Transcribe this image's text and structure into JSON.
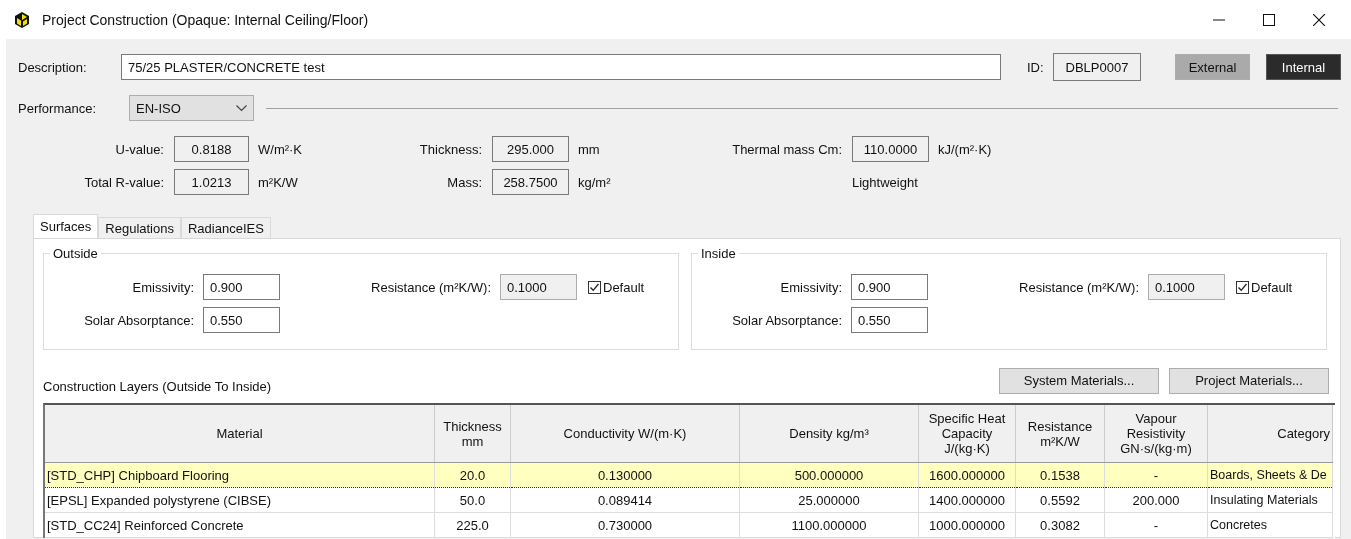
{
  "window": {
    "title": "Project Construction (Opaque: Internal Ceiling/Floor)"
  },
  "description": {
    "label": "Description:",
    "value": "75/25 PLASTER/CONCRETE test"
  },
  "id": {
    "label": "ID:",
    "value": "DBLP0007"
  },
  "modes": [
    {
      "label": "External",
      "selected": false
    },
    {
      "label": "Internal",
      "selected": true
    }
  ],
  "performance": {
    "label": "Performance:",
    "value": "EN-ISO"
  },
  "property_columns": [
    {
      "items": [
        {
          "kind": "field",
          "label": "U-value:",
          "value": "0.8188",
          "unit": "W/m²·K"
        },
        {
          "kind": "field",
          "label": "Total R-value:",
          "value": "1.0213",
          "unit": "m²K/W"
        }
      ]
    },
    {
      "items": [
        {
          "kind": "field",
          "label": "Thickness:",
          "value": "295.000",
          "unit": "mm"
        },
        {
          "kind": "field",
          "label": "Mass:",
          "value": "258.7500",
          "unit": "kg/m²"
        }
      ]
    },
    {
      "items": [
        {
          "kind": "field",
          "label": "Thermal mass Cm:",
          "value": "110.0000",
          "unit": "kJ/(m²·K)"
        },
        {
          "kind": "note",
          "text": "Lightweight"
        }
      ]
    }
  ],
  "tabs": [
    {
      "label": "Surfaces",
      "selected": true
    },
    {
      "label": "Regulations",
      "selected": false
    },
    {
      "label": "RadianceIES",
      "selected": false
    }
  ],
  "surfaces": [
    {
      "title": "Outside",
      "fields": [
        {
          "label": "Emissivity:",
          "value": "0.900"
        },
        {
          "label": "Solar Absorptance:",
          "value": "0.550"
        }
      ],
      "resistance": {
        "label": "Resistance (m²K/W):",
        "value": "0.1000",
        "disabled": true
      },
      "default": {
        "label": "Default",
        "checked": true
      }
    },
    {
      "title": "Inside",
      "fields": [
        {
          "label": "Emissivity:",
          "value": "0.900"
        },
        {
          "label": "Solar Absorptance:",
          "value": "0.550"
        }
      ],
      "resistance": {
        "label": "Resistance (m²K/W):",
        "value": "0.1000",
        "disabled": true
      },
      "default": {
        "label": "Default",
        "checked": true
      }
    }
  ],
  "layers": {
    "title": "Construction Layers (Outside To Inside)",
    "buttons": [
      "System Materials...",
      "Project Materials..."
    ],
    "columns": [
      "Material",
      "Thickness\nmm",
      "Conductivity W/(m·K)",
      "Density kg/m³",
      "Specific Heat\nCapacity\nJ/(kg·K)",
      "Resistance\nm²K/W",
      "Vapour\nResistivity\nGN·s/(kg·m)",
      "Category"
    ],
    "rows": [
      {
        "selected": true,
        "cells": [
          "[STD_CHP] Chipboard Flooring",
          "20.0",
          "0.130000",
          "500.000000",
          "1600.000000",
          "0.1538",
          "-",
          "Boards, Sheets & De"
        ]
      },
      {
        "selected": false,
        "cells": [
          "[EPSL] Expanded polystyrene (CIBSE)",
          "50.0",
          "0.089414",
          "25.000000",
          "1400.000000",
          "0.5592",
          "200.000",
          "Insulating Materials"
        ]
      },
      {
        "selected": false,
        "cells": [
          "[STD_CC24] Reinforced Concrete",
          "225.0",
          "0.730000",
          "1100.000000",
          "1000.000000",
          "0.3082",
          "-",
          "Concretes"
        ]
      }
    ]
  }
}
